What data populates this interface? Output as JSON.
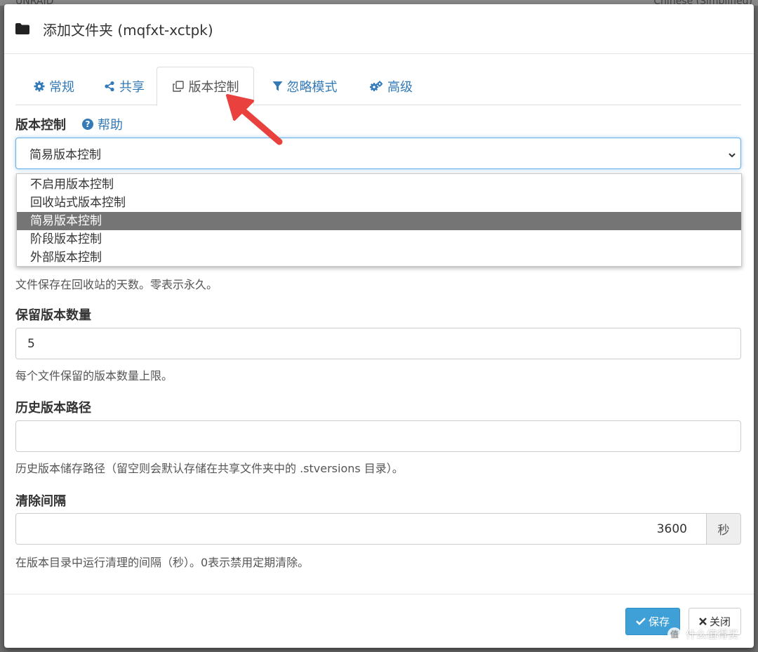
{
  "backdrop": {
    "left_text": "UNRAID",
    "right_text": "Chinese (Simplified)"
  },
  "modal": {
    "title": "添加文件夹 (mqfxt-xctpk)",
    "tabs": [
      {
        "label": "常规",
        "icon": "gear-icon"
      },
      {
        "label": "共享",
        "icon": "share-icon"
      },
      {
        "label": "版本控制",
        "icon": "copy-icon",
        "active": true
      },
      {
        "label": "忽略模式",
        "icon": "filter-icon"
      },
      {
        "label": "高级",
        "icon": "gears-icon"
      }
    ],
    "versioning": {
      "label": "版本控制",
      "help_label": "帮助",
      "selected": "简易版本控制",
      "options": [
        "不启用版本控制",
        "回收站式版本控制",
        "简易版本控制",
        "阶段版本控制",
        "外部版本控制"
      ]
    },
    "trash_days_help": "文件保存在回收站的天数。零表示永久。",
    "keep_versions": {
      "label": "保留版本数量",
      "value": "5",
      "help": "每个文件保留的版本数量上限。"
    },
    "versions_path": {
      "label": "历史版本路径",
      "value": "",
      "help": "历史版本储存路径（留空则会默认存储在共享文件夹中的 .stversions 目录）。"
    },
    "cleanup_interval": {
      "label": "清除间隔",
      "value": "3600",
      "unit": "秒",
      "help": "在版本目录中运行清理的间隔（秒）。0表示禁用定期清除。"
    },
    "footer": {
      "save_label": "保存",
      "close_label": "关闭"
    }
  },
  "watermark": "什么值得买",
  "colors": {
    "link": "#337ab7",
    "primary": "#3fa0d8",
    "selected_option": "#757575",
    "annotation_arrow": "#e8413e"
  }
}
